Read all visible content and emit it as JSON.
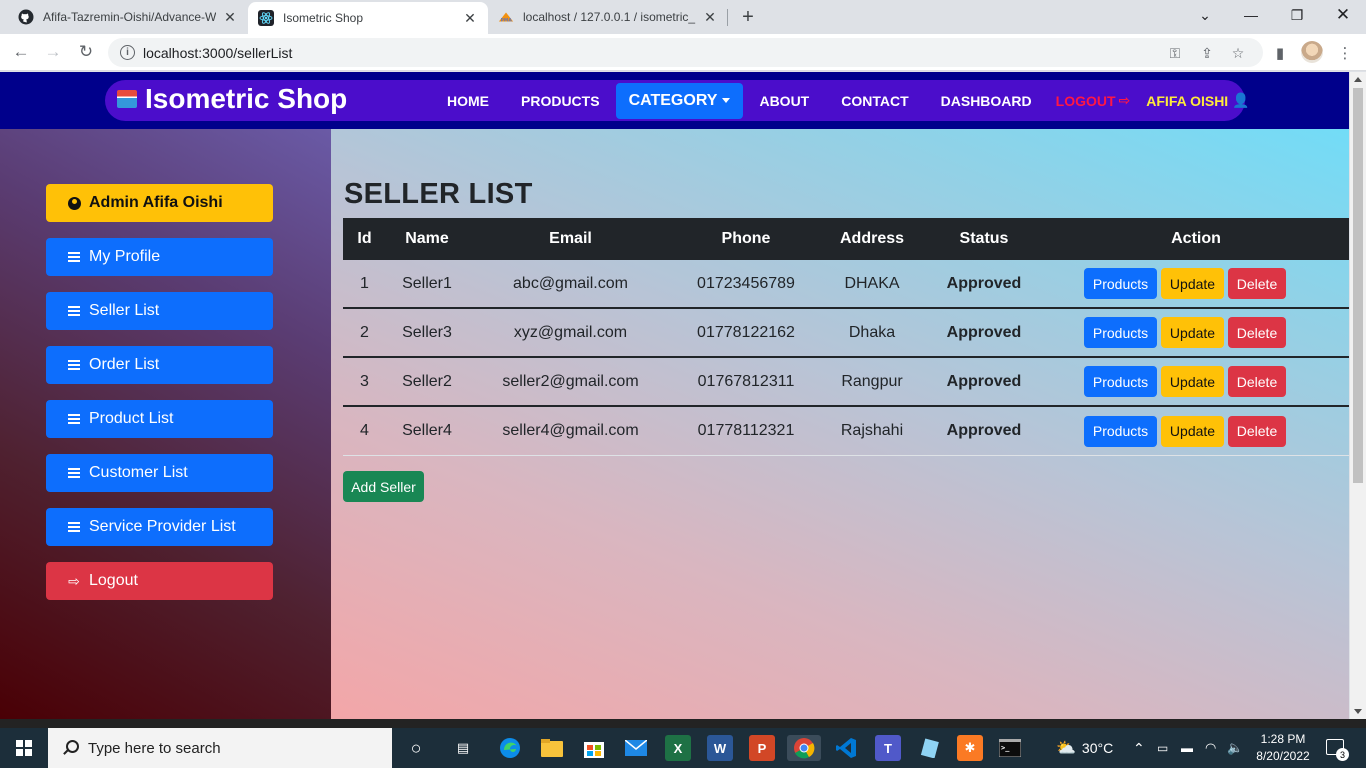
{
  "browser": {
    "tabs": [
      {
        "title": "Afifa-Tazremin-Oishi/Advance-W",
        "icon": "github-icon"
      },
      {
        "title": "Isometric Shop",
        "icon": "react-icon"
      },
      {
        "title": "localhost / 127.0.0.1 / isometric_",
        "icon": "phpmyadmin-icon"
      }
    ],
    "url": "localhost:3000/sellerList"
  },
  "site": {
    "brand": "Isometric Shop",
    "nav": {
      "home": "HOME",
      "products": "PRODUCTS",
      "category": "CATEGORY",
      "about": "ABOUT",
      "contact": "CONTACT",
      "dashboard": "DASHBOARD",
      "logout": "LOGOUT",
      "user": "AFIFA OISHI"
    }
  },
  "sidebar": {
    "admin": "Admin Afifa Oishi",
    "items": [
      "My Profile",
      "Seller List",
      "Order List",
      "Product List",
      "Customer List",
      "Service Provider List"
    ],
    "logout": "Logout"
  },
  "main": {
    "title": "SELLER LIST",
    "columns": [
      "Id",
      "Name",
      "Email",
      "Phone",
      "Address",
      "Status",
      "Action"
    ],
    "rows": [
      {
        "id": "1",
        "name": "Seller1",
        "email": "abc@gmail.com",
        "phone": "01723456789",
        "address": "DHAKA",
        "status": "Approved"
      },
      {
        "id": "2",
        "name": "Seller3",
        "email": "xyz@gmail.com",
        "phone": "01778122162",
        "address": "Dhaka",
        "status": "Approved"
      },
      {
        "id": "3",
        "name": "Seller2",
        "email": "seller2@gmail.com",
        "phone": "01767812311",
        "address": "Rangpur",
        "status": "Approved"
      },
      {
        "id": "4",
        "name": "Seller4",
        "email": "seller4@gmail.com",
        "phone": "01778112321",
        "address": "Rajshahi",
        "status": "Approved"
      }
    ],
    "actions": {
      "products": "Products",
      "update": "Update",
      "delete": "Delete"
    },
    "add_button": "Add Seller"
  },
  "taskbar": {
    "search_placeholder": "Type here to search",
    "weather": "30°C",
    "time": "1:28 PM",
    "date": "8/20/2022",
    "notifications": "3"
  },
  "colors": {
    "header": "#00008b",
    "nav_pill": "#4b0dcb",
    "primary": "#0d6efd",
    "warning": "#ffc107",
    "danger": "#dc3545",
    "success": "#198754",
    "table_head": "#212529"
  }
}
